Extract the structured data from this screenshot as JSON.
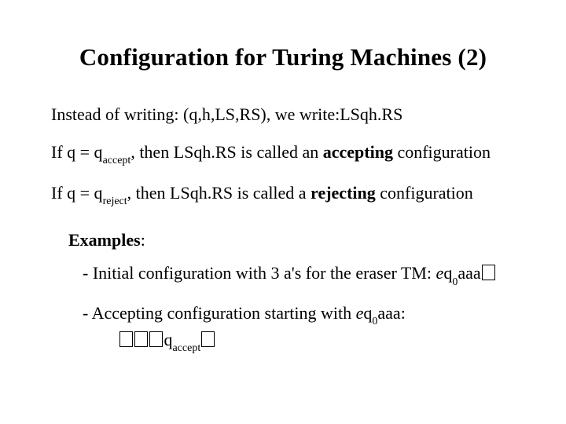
{
  "title": "Configuration for Turing Machines (2)",
  "line1_a": "Instead of writing: (q,h,LS,RS), we write:LSqh.RS",
  "line2_a": "If q = q",
  "line2_sub": "accept",
  "line2_b": ", then  LSqh.RS is called an ",
  "line2_bold": "accepting",
  "line2_c": " configuration",
  "line3_a": "If q = q",
  "line3_sub": "reject",
  "line3_b": ", then LSqh.RS is called a ",
  "line3_bold": "rejecting",
  "line3_c": " configuration",
  "examples_label": "Examples",
  "colon": ":",
  "ex1_a": "- Initial configuration with 3 a's for the eraser TM: ",
  "ex1_e": "e",
  "ex1_q": "q",
  "ex1_sub": "0",
  "ex1_tail": "aaa",
  "ex2_a": "- Accepting configuration starting with ",
  "ex2_e": "e",
  "ex2_q": "q",
  "ex2_sub": "0",
  "ex2_mid": "aaa:",
  "ex2_rq": "q",
  "ex2_rsub": "accept"
}
